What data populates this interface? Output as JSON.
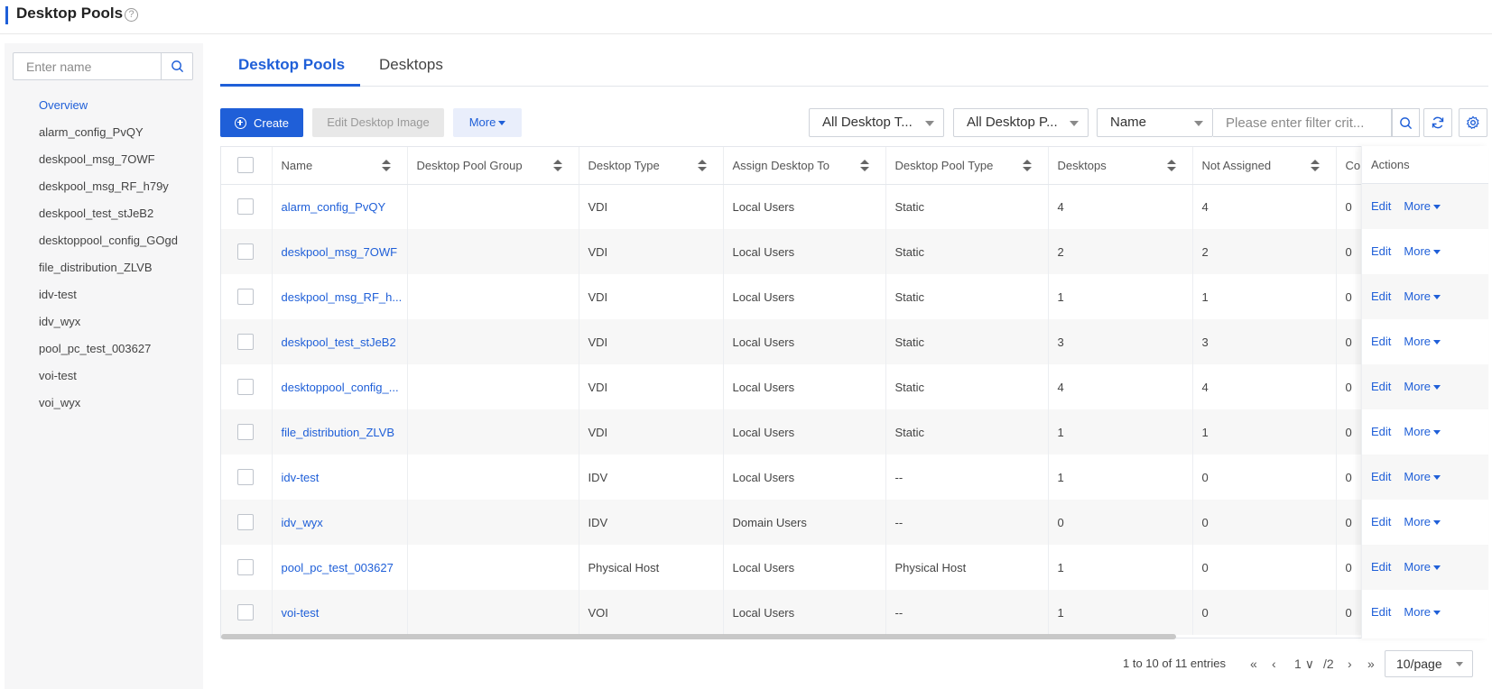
{
  "header": {
    "title": "Desktop Pools",
    "help_icon": "?"
  },
  "sidebar": {
    "search_placeholder": "Enter name",
    "items": [
      {
        "label": "Overview",
        "active": true
      },
      {
        "label": "alarm_config_PvQY"
      },
      {
        "label": "deskpool_msg_7OWF"
      },
      {
        "label": "deskpool_msg_RF_h79y"
      },
      {
        "label": "deskpool_test_stJeB2"
      },
      {
        "label": "desktoppool_config_GOgd"
      },
      {
        "label": "file_distribution_ZLVB"
      },
      {
        "label": "idv-test"
      },
      {
        "label": "idv_wyx"
      },
      {
        "label": "pool_pc_test_003627"
      },
      {
        "label": "voi-test"
      },
      {
        "label": "voi_wyx"
      }
    ]
  },
  "tabs": [
    {
      "label": "Desktop Pools",
      "active": true
    },
    {
      "label": "Desktops"
    }
  ],
  "toolbar": {
    "create_label": "Create",
    "edit_image_label": "Edit Desktop Image",
    "more_label": "More",
    "filter_desktop_type": "All Desktop T...",
    "filter_desktop_pool": "All Desktop P...",
    "filter_field": "Name",
    "filter_placeholder": "Please enter filter crit..."
  },
  "table": {
    "columns": [
      "Name",
      "Desktop Pool Group",
      "Desktop Type",
      "Assign Desktop To",
      "Desktop Pool Type",
      "Desktops",
      "Not Assigned",
      "Co"
    ],
    "actions_header": "Actions",
    "edit_label": "Edit",
    "more_label": "More",
    "rows": [
      {
        "name": "alarm_config_PvQY",
        "group": "",
        "type": "VDI",
        "assign": "Local Users",
        "pool_type": "Static",
        "desktops": "4",
        "not_assigned": "4",
        "co": "0"
      },
      {
        "name": "deskpool_msg_7OWF",
        "group": "",
        "type": "VDI",
        "assign": "Local Users",
        "pool_type": "Static",
        "desktops": "2",
        "not_assigned": "2",
        "co": "0"
      },
      {
        "name": "deskpool_msg_RF_h...",
        "group": "",
        "type": "VDI",
        "assign": "Local Users",
        "pool_type": "Static",
        "desktops": "1",
        "not_assigned": "1",
        "co": "0"
      },
      {
        "name": "deskpool_test_stJeB2",
        "group": "",
        "type": "VDI",
        "assign": "Local Users",
        "pool_type": "Static",
        "desktops": "3",
        "not_assigned": "3",
        "co": "0"
      },
      {
        "name": "desktoppool_config_...",
        "group": "",
        "type": "VDI",
        "assign": "Local Users",
        "pool_type": "Static",
        "desktops": "4",
        "not_assigned": "4",
        "co": "0"
      },
      {
        "name": "file_distribution_ZLVB",
        "group": "",
        "type": "VDI",
        "assign": "Local Users",
        "pool_type": "Static",
        "desktops": "1",
        "not_assigned": "1",
        "co": "0"
      },
      {
        "name": "idv-test",
        "group": "",
        "type": "IDV",
        "assign": "Local Users",
        "pool_type": "--",
        "desktops": "1",
        "not_assigned": "0",
        "co": "0"
      },
      {
        "name": "idv_wyx",
        "group": "",
        "type": "IDV",
        "assign": "Domain Users",
        "pool_type": "--",
        "desktops": "0",
        "not_assigned": "0",
        "co": "0"
      },
      {
        "name": "pool_pc_test_003627",
        "group": "",
        "type": "Physical Host",
        "assign": "Local Users",
        "pool_type": "Physical Host",
        "desktops": "1",
        "not_assigned": "0",
        "co": "0"
      },
      {
        "name": "voi-test",
        "group": "",
        "type": "VOI",
        "assign": "Local Users",
        "pool_type": "--",
        "desktops": "1",
        "not_assigned": "0",
        "co": "0"
      }
    ]
  },
  "pagination": {
    "summary": "1 to 10 of 11 entries",
    "current_page": "1",
    "total_pages": "/2",
    "page_size": "10/page"
  },
  "colors": {
    "accent": "#1f5fd8",
    "sidebar_bg": "#f6f6f7",
    "row_alt": "#f7f7f7"
  }
}
